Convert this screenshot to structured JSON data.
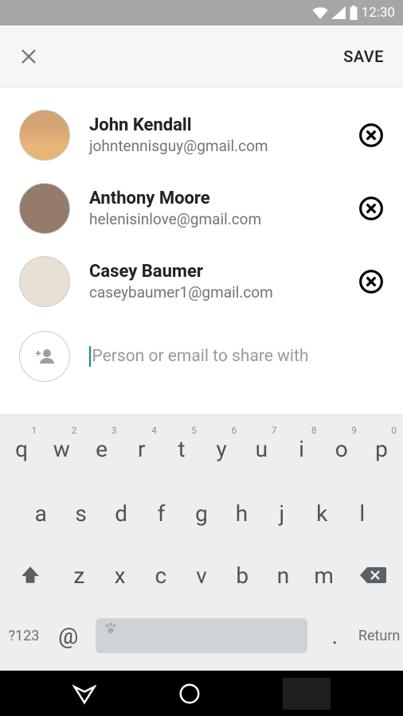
{
  "status": {
    "time": "12:30"
  },
  "header": {
    "save_label": "SAVE"
  },
  "contacts": [
    {
      "name": "John Kendall",
      "email": "johntennisguy@gmail.com"
    },
    {
      "name": "Anthony Moore",
      "email": "helenisinlove@gmail.com"
    },
    {
      "name": "Casey Baumer",
      "email": "caseybaumer1@gmail.com"
    }
  ],
  "input": {
    "placeholder": "Person or email to share with"
  },
  "keyboard": {
    "row1": [
      "q",
      "w",
      "e",
      "r",
      "t",
      "y",
      "u",
      "i",
      "o",
      "p"
    ],
    "nums": [
      "1",
      "2",
      "3",
      "4",
      "5",
      "6",
      "7",
      "8",
      "9",
      "0"
    ],
    "row2": [
      "a",
      "s",
      "d",
      "f",
      "g",
      "h",
      "j",
      "k",
      "l"
    ],
    "row3": [
      "z",
      "x",
      "c",
      "v",
      "b",
      "n",
      "m"
    ],
    "sym": "?123",
    "at": "@",
    "dot": ".",
    "return": "Return"
  }
}
